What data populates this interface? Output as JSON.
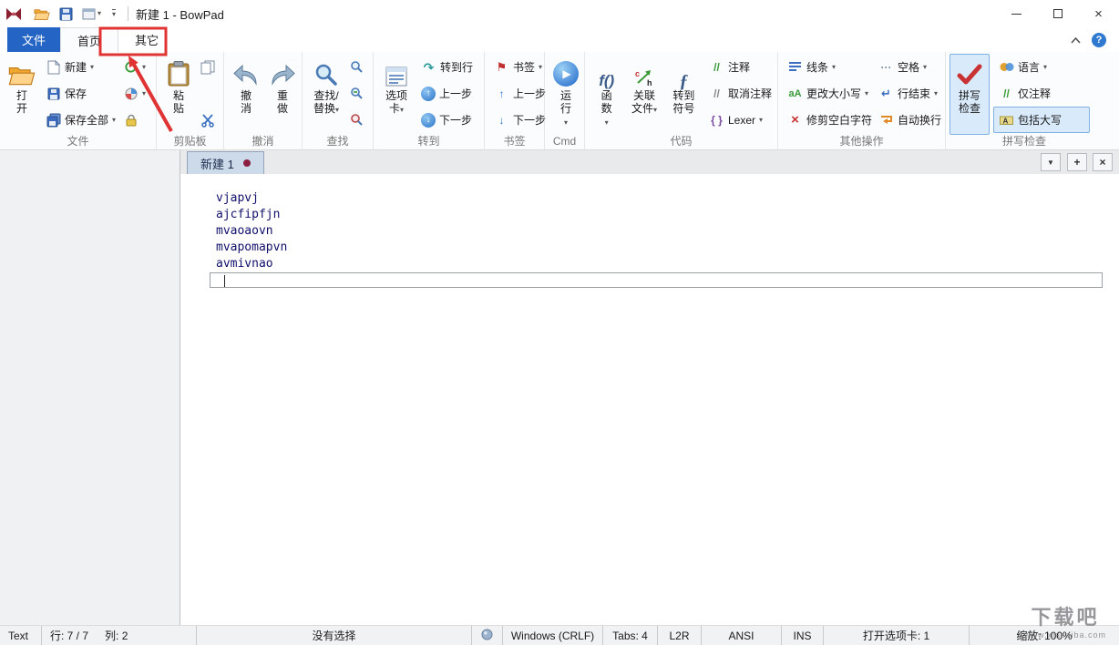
{
  "icons": {
    "dropdown": "▾",
    "tab_menu": "▼",
    "tab_add": "+",
    "tab_close": "×",
    "window_close": "×",
    "help": "?",
    "up_arrow": "↑",
    "down_arrow": "↓",
    "play": "▶",
    "flag": "⚑",
    "comment": "//",
    "lexer_braces": "{ }",
    "function": "f()",
    "symbol": "ƒ",
    "trim_x": "×",
    "case": "aA",
    "spaces_dots": "···",
    "line_end_arrow": "↵",
    "goto_line_arrow": "↷"
  },
  "titlebar": {
    "title": "新建 1 - BowPad"
  },
  "tabs": {
    "file": "文件",
    "home": "首页",
    "other": "其它"
  },
  "ribbon": {
    "file": {
      "label": "文件",
      "open": "打开",
      "new": "新建",
      "save": "保存",
      "save_all": "保存全部"
    },
    "clipboard": {
      "label": "剪贴板",
      "paste": "粘贴"
    },
    "undo": {
      "label": "撤消",
      "undo": "撤消",
      "redo": "重做"
    },
    "find": {
      "label": "查找",
      "find_replace": "查找/替换"
    },
    "goto": {
      "label": "转到",
      "tabs": "选项卡",
      "goto_line": "转到行",
      "prev": "上一步",
      "next": "下一步"
    },
    "bookmarks": {
      "label": "书签",
      "bookmark": "书签",
      "prev": "上一步",
      "next": "下一步"
    },
    "cmd": {
      "label": "Cmd",
      "run": "运行"
    },
    "code": {
      "label": "代码",
      "function": "函数",
      "related": "关联文件",
      "symbol": "转到符号",
      "comment": "注释",
      "uncomment": "取消注释",
      "lexer": "Lexer"
    },
    "other": {
      "label": "其他操作",
      "lines": "线条",
      "case": "更改大小写",
      "trim": "修剪空白字符",
      "spaces": "空格",
      "line_end": "行结束",
      "wrap": "自动换行"
    },
    "spell": {
      "label": "拼写检查",
      "check": "拼写检查",
      "language": "语言",
      "comments_only": "仅注释",
      "include_upper": "包括大写"
    }
  },
  "tabbar": {
    "active": "新建 1"
  },
  "editor": {
    "lines": [
      "vjapvj",
      "ajcfipfjn",
      "mvaoaovn",
      "mvapomapvn",
      "avmivnao"
    ]
  },
  "statusbar": {
    "type": "Text",
    "line": "行: 7 / 7",
    "col": "列: 2",
    "selection": "没有选择",
    "eol": "Windows (CRLF)",
    "tabs": "Tabs: 4",
    "direction": "L2R",
    "encoding": "ANSI",
    "mode": "INS",
    "open_tabs": "打开选项卡: 1",
    "zoom": "缩放: 100%"
  },
  "watermark": {
    "title": "下载吧",
    "subtitle": "www.xiazaiba.com"
  }
}
